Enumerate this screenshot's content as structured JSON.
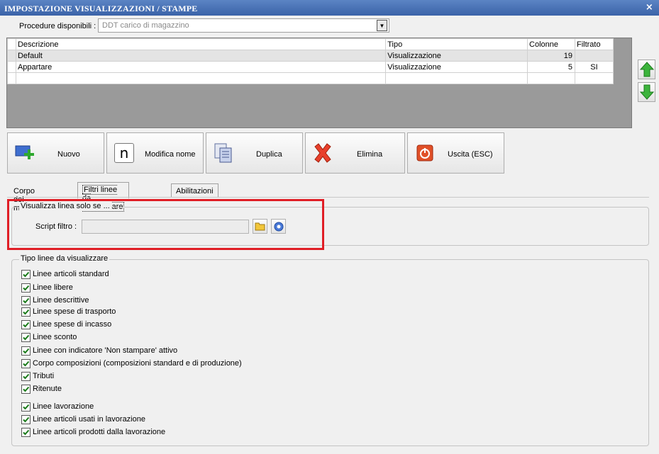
{
  "window": {
    "title": "IMPOSTAZIONE VISUALIZZAZIONI / STAMPE",
    "close_glyph": "×"
  },
  "procedure": {
    "label": "Procedure disponibili :",
    "value": "DDT carico di magazzino"
  },
  "grid": {
    "columns": [
      "Descrizione",
      "Tipo",
      "Colonne",
      "Filtrato"
    ],
    "rows": [
      {
        "descrizione": "Default",
        "tipo": "Visualizzazione",
        "colonne": "19",
        "filtrato": ""
      },
      {
        "descrizione": "Appartare",
        "tipo": "Visualizzazione",
        "colonne": "5",
        "filtrato": "SI"
      }
    ]
  },
  "toolbar": {
    "nuovo": "Nuovo",
    "modifica_icon_letter": "n",
    "modifica": "Modifica nome",
    "duplica": "Duplica",
    "elimina": "Elimina",
    "uscita": "Uscita (ESC)"
  },
  "tabs": [
    "Corpo del modello",
    "Filtri linee da visualizzare",
    "Abilitazioni"
  ],
  "filter_group": {
    "legend": "Visualizza linea solo se ...",
    "script_label": "Script filtro :",
    "script_value": ""
  },
  "types_group": {
    "legend": "Tipo linee da visualizzare",
    "items": [
      {
        "label": "Linee articoli standard",
        "checked": true
      },
      {
        "label": "Linee libere",
        "checked": true
      },
      {
        "label": "Linee descrittive",
        "checked": true
      },
      {
        "label": "Linee spese di trasporto",
        "checked": true
      },
      {
        "label": "Linee spese di incasso",
        "checked": true
      },
      {
        "label": "Linee sconto",
        "checked": true
      },
      {
        "label": "Linee con indicatore 'Non stampare' attivo",
        "checked": true
      },
      {
        "label": "Corpo composizioni (composizioni standard e di produzione)",
        "checked": true
      },
      {
        "label": "Tributi",
        "checked": true
      },
      {
        "label": "Ritenute",
        "checked": true
      },
      {
        "label": "Linee lavorazione",
        "checked": true
      },
      {
        "label": "Linee articoli usati in lavorazione",
        "checked": true
      },
      {
        "label": "Linee articoli prodotti dalla lavorazione",
        "checked": true
      }
    ]
  },
  "colors": {
    "highlight_border": "#e01e26",
    "titlebar": "#3b63a8",
    "arrow_green": "#3cb43c"
  }
}
